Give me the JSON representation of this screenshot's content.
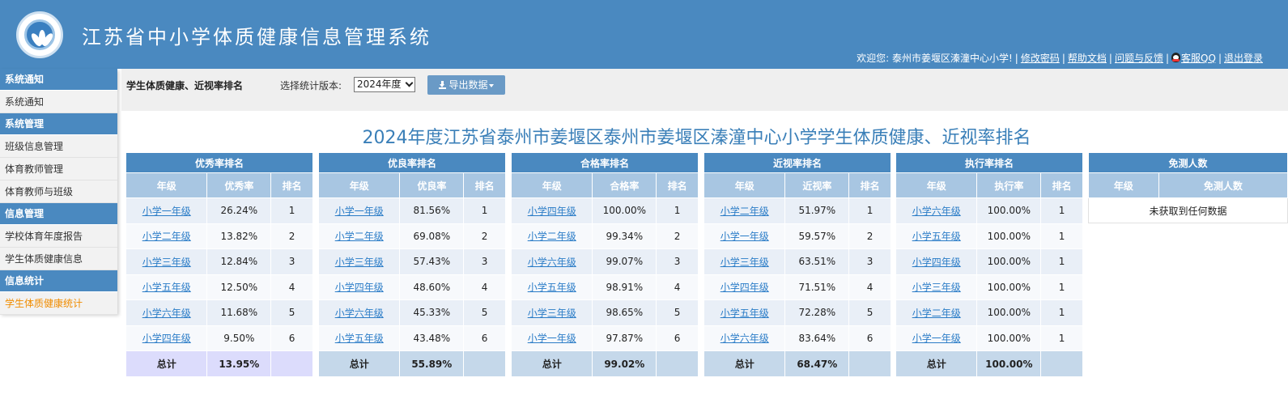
{
  "header": {
    "title": "江苏省中小学体质健康信息管理系统",
    "welcome": "欢迎您: 泰州市姜堰区溱潼中心小学!",
    "links": {
      "change_password": "修改密码",
      "help": "帮助文档",
      "feedback": "问题与反馈",
      "service_qq": "客服QQ",
      "logout": "退出登录"
    }
  },
  "sidebar": {
    "groups": [
      {
        "title": "系统通知",
        "items": [
          "系统通知"
        ]
      },
      {
        "title": "系统管理",
        "items": [
          "班级信息管理",
          "体育教师管理",
          "体育教师与班级"
        ]
      },
      {
        "title": "信息管理",
        "items": [
          "学校体育年度报告",
          "学生体质健康信息"
        ]
      },
      {
        "title": "信息统计",
        "items": [
          "学生体质健康统计"
        ]
      }
    ],
    "active_item": "学生体质健康统计"
  },
  "toolbar": {
    "title": "学生体质健康、近视率排名",
    "version_label": "选择统计版本:",
    "version_value": "2024年度",
    "export_label": "导出数据"
  },
  "page_heading": "2024年度江苏省泰州市姜堰区泰州市姜堰区溱潼中心小学学生体质健康、近视率排名",
  "tables": [
    {
      "title": "优秀率排名",
      "columns": [
        "年级",
        "优秀率",
        "排名"
      ],
      "rows": [
        [
          "小学一年级",
          "26.24%",
          "1"
        ],
        [
          "小学二年级",
          "13.82%",
          "2"
        ],
        [
          "小学三年级",
          "12.84%",
          "3"
        ],
        [
          "小学五年级",
          "12.50%",
          "4"
        ],
        [
          "小学六年级",
          "11.68%",
          "5"
        ],
        [
          "小学四年级",
          "9.50%",
          "6"
        ]
      ],
      "total_label": "总计",
      "total_value": "13.95%"
    },
    {
      "title": "优良率排名",
      "columns": [
        "年级",
        "优良率",
        "排名"
      ],
      "rows": [
        [
          "小学一年级",
          "81.56%",
          "1"
        ],
        [
          "小学二年级",
          "69.08%",
          "2"
        ],
        [
          "小学三年级",
          "57.43%",
          "3"
        ],
        [
          "小学四年级",
          "48.60%",
          "4"
        ],
        [
          "小学六年级",
          "45.33%",
          "5"
        ],
        [
          "小学五年级",
          "43.48%",
          "6"
        ]
      ],
      "total_label": "总计",
      "total_value": "55.89%"
    },
    {
      "title": "合格率排名",
      "columns": [
        "年级",
        "合格率",
        "排名"
      ],
      "rows": [
        [
          "小学四年级",
          "100.00%",
          "1"
        ],
        [
          "小学二年级",
          "99.34%",
          "2"
        ],
        [
          "小学六年级",
          "99.07%",
          "3"
        ],
        [
          "小学五年级",
          "98.91%",
          "4"
        ],
        [
          "小学三年级",
          "98.65%",
          "5"
        ],
        [
          "小学一年级",
          "97.87%",
          "6"
        ]
      ],
      "total_label": "总计",
      "total_value": "99.02%"
    },
    {
      "title": "近视率排名",
      "columns": [
        "年级",
        "近视率",
        "排名"
      ],
      "rows": [
        [
          "小学二年级",
          "51.97%",
          "1"
        ],
        [
          "小学一年级",
          "59.57%",
          "2"
        ],
        [
          "小学三年级",
          "63.51%",
          "3"
        ],
        [
          "小学四年级",
          "71.51%",
          "4"
        ],
        [
          "小学五年级",
          "72.28%",
          "5"
        ],
        [
          "小学六年级",
          "83.64%",
          "6"
        ]
      ],
      "total_label": "总计",
      "total_value": "68.47%"
    },
    {
      "title": "执行率排名",
      "columns": [
        "年级",
        "执行率",
        "排名"
      ],
      "rows": [
        [
          "小学六年级",
          "100.00%",
          "1"
        ],
        [
          "小学五年级",
          "100.00%",
          "1"
        ],
        [
          "小学四年级",
          "100.00%",
          "1"
        ],
        [
          "小学三年级",
          "100.00%",
          "1"
        ],
        [
          "小学二年级",
          "100.00%",
          "1"
        ],
        [
          "小学一年级",
          "100.00%",
          "1"
        ]
      ],
      "total_label": "总计",
      "total_value": "100.00%"
    }
  ],
  "exempt_table": {
    "title": "免测人数",
    "columns": [
      "年级",
      "免测人数"
    ],
    "empty_message": "未获取到任何数据"
  },
  "colors": {
    "header_bg": "#4a89c0",
    "table_head": "#a8c6e2",
    "link": "#2a7cc7",
    "active_menu": "#f08c00",
    "total_first": "#dcdcfc",
    "total_other": "#c5d8ea"
  }
}
